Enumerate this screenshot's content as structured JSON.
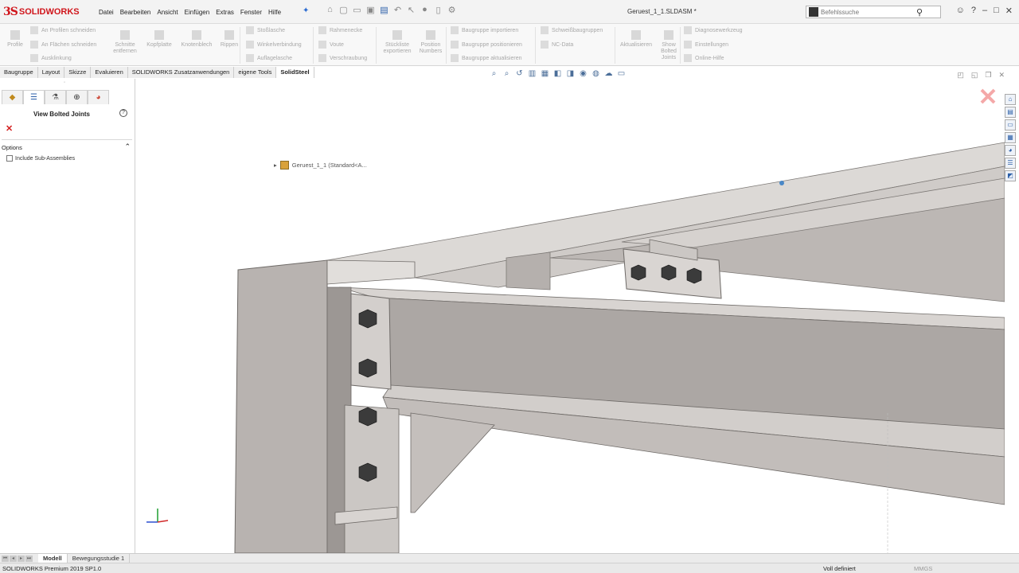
{
  "titlebar": {
    "logo_ds": "3S",
    "logo_text": "SOLIDWORKS",
    "menu": [
      "Datei",
      "Bearbeiten",
      "Ansicht",
      "Einfügen",
      "Extras",
      "Fenster",
      "Hilfe"
    ],
    "document_title": "Geruest_1_1.SLDASM *",
    "search_placeholder": "Befehlssuche"
  },
  "command_manager": {
    "profile": "Profile",
    "cut_profiles": "An Profilen schneiden",
    "cut_faces": "An Flächen schneiden",
    "notch": "Ausklinkung",
    "remove_cuts": "Schnitte entfernen",
    "head_plate": "Kopfplatte",
    "gusset": "Knotenblech",
    "ribs": "Rippen",
    "splice": "Stoßlasche",
    "angle": "Winkelverbindung",
    "support": "Auflagelasche",
    "frame_corner": "Rahmenecke",
    "haunch": "Voute",
    "bolting": "Verschraubung",
    "export_bom": "Stückliste exportieren",
    "position_numbers": "Position Numbers",
    "import_assembly": "Baugruppe importieren",
    "position_assembly": "Baugruppe positionieren",
    "update_assembly": "Baugruppe aktualisieren",
    "weld_assemblies": "Schweißbaugruppen",
    "nc_data": "NC-Data",
    "update": "Aktualisieren",
    "show_bolted_joints": "Show Bolted Joints",
    "diagnostics": "Diagnosewerkzeug",
    "settings": "Einstellungen",
    "online_help": "Online-Hilfe"
  },
  "tabs": [
    "Baugruppe",
    "Layout",
    "Skizze",
    "Evaluieren",
    "SOLIDWORKS Zusatzanwendungen",
    "eigene Tools",
    "SolidSteel"
  ],
  "active_tab": "SolidSteel",
  "property_manager": {
    "title": "View Bolted Joints",
    "options_label": "Options",
    "include_subassemblies": "Include Sub-Assemblies",
    "include_subassemblies_checked": false
  },
  "tree": {
    "root": "Geruest_1_1  (Standard<A..."
  },
  "bottom_tabs": [
    "Modell",
    "Bewegungsstudie 1"
  ],
  "active_bottom_tab": "Modell",
  "statusbar": {
    "product": "SOLIDWORKS Premium 2019 SP1.0",
    "state": "Voll definiert",
    "units": "MMGS"
  },
  "colors": {
    "accent": "#d0151b",
    "steel_light": "#dcd9d6",
    "steel_mid": "#b9b4b1",
    "steel_dark": "#8f8a86",
    "bolt": "#3a3a3a"
  }
}
